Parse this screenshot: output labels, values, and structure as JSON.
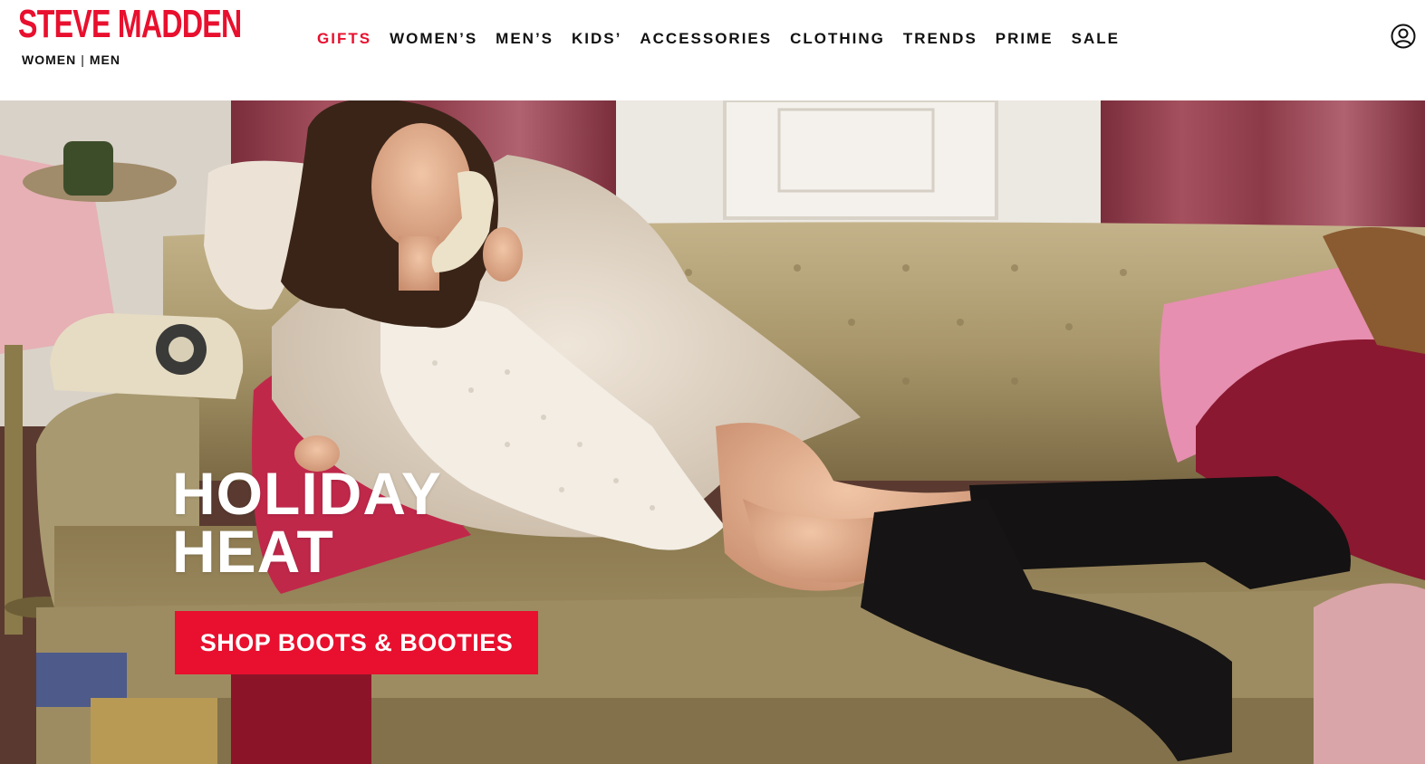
{
  "brand": {
    "logo_text": "STEVE MADDEN",
    "logo_color": "#e8102e"
  },
  "gender_switch": {
    "women": "WOMEN",
    "separator": "|",
    "men": "MEN"
  },
  "nav": {
    "items": [
      {
        "label": "GIFTS",
        "highlight": true
      },
      {
        "label": "WOMEN’S"
      },
      {
        "label": "MEN’S"
      },
      {
        "label": "KIDS’"
      },
      {
        "label": "ACCESSORIES"
      },
      {
        "label": "CLOTHING"
      },
      {
        "label": "TRENDS"
      },
      {
        "label": "PRIME"
      },
      {
        "label": "SALE"
      }
    ],
    "account_icon": "user-account-icon"
  },
  "hero": {
    "title_line1": "HOLIDAY",
    "title_line2": "HEAT",
    "cta_label": "SHOP BOOTS & BOOTIES",
    "cta_color": "#e8102e",
    "image_subject": "model-on-velvet-sofa-with-telephone"
  }
}
